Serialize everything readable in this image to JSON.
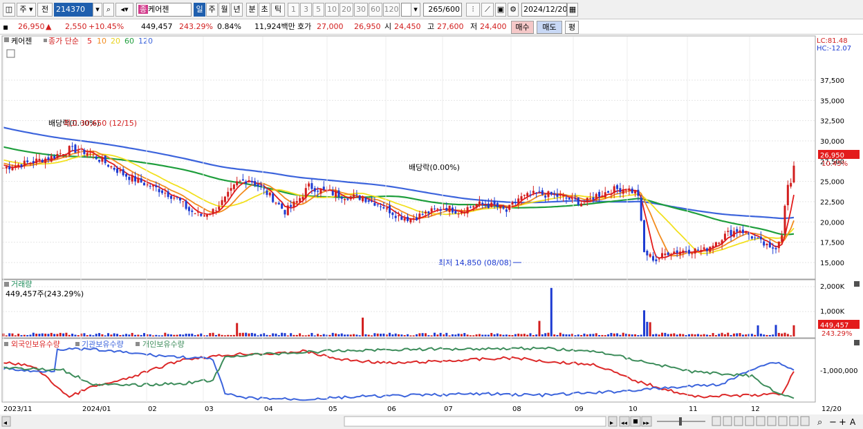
{
  "toolbar": {
    "period_mode": "주",
    "prev_label": "전",
    "code": "214370",
    "name": "케어젠",
    "name_tag": "종",
    "period_buttons": [
      "일",
      "주",
      "월",
      "년",
      "분",
      "초",
      "틱"
    ],
    "interval_buttons": [
      "1",
      "3",
      "5",
      "10",
      "20",
      "30",
      "60",
      "120"
    ],
    "count": "265",
    "count_max": "/600",
    "date": "2024/12/20"
  },
  "quote": {
    "price": "26,950",
    "change_arrow": "▲",
    "change": "2,550",
    "change_pct": "+10.45%",
    "volume": "449,457",
    "volume_ratio": "243.29%",
    "turnover_pct": "0.84%",
    "amount": "11,924백만",
    "ask_label": "호가",
    "ask1": "27,000",
    "ask2": "26,950",
    "open_label": "시",
    "open": "24,450",
    "high_label": "고",
    "high": "27,600",
    "low_label": "저",
    "low": "24,400",
    "buy": "매수",
    "sell": "매도",
    "avg": "평"
  },
  "price_panel": {
    "stock_label": "케어젠",
    "ma_label": "종가 단순",
    "ma_periods": [
      "5",
      "10",
      "20",
      "60",
      "120"
    ],
    "lc": "LC:81.48",
    "hc": "HC:-12.07",
    "current_price": "26,950",
    "current_pct": "10.45%",
    "y_ticks": [
      "37,500",
      "35,000",
      "32,500",
      "30,000",
      "27,500",
      "25,000",
      "22,500",
      "20,000",
      "17,500",
      "15,000"
    ],
    "annotation_dividend1": "배당락(0.00%)",
    "annotation_high": "최고 30,650 (12/15)",
    "annotation_dividend2": "배당락(0.00%)",
    "annotation_low": "최저 14,850 (08/08)"
  },
  "volume_panel": {
    "label": "거래량",
    "value": "449,457주(243.29%)",
    "y_ticks": [
      "2,000K",
      "1,000K"
    ],
    "current": "449,457",
    "current_pct": "243.29%"
  },
  "holding_panel": {
    "labels": [
      "외국인보유수량",
      "기관보유수량",
      "개인보유수량"
    ],
    "y_tick": "-1,000,000"
  },
  "x_axis": {
    "labels": [
      "2023/11",
      "2024/01",
      "02",
      "03",
      "04",
      "05",
      "06",
      "07",
      "08",
      "09",
      "10",
      "11",
      "12",
      "12/20"
    ]
  },
  "colors": {
    "up": "#d21e1e",
    "down": "#1e3cd2",
    "ma5": "#e31b1b",
    "ma10": "#f28c1e",
    "ma20": "#f2e01e",
    "ma60": "#1e9e3c",
    "ma120": "#3c64dc",
    "foreign": "#dc2828",
    "institution": "#3c64dc",
    "individual": "#3c8c5a"
  }
}
